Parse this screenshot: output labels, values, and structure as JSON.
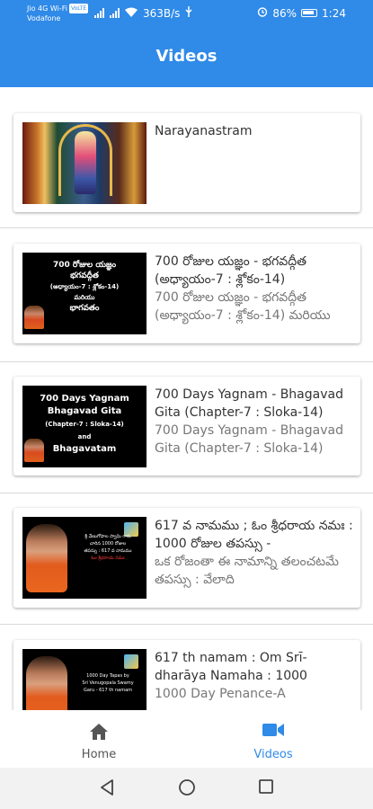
{
  "status_bar": {
    "carrier_top": "Jio 4G Wi-Fi",
    "lte_badge": "VoLTE",
    "carrier_bottom": "Vodafone",
    "net_speed": "363B/s",
    "battery": "86%",
    "time": "1:24"
  },
  "header": {
    "title": "Videos"
  },
  "videos": [
    {
      "title": "Narayanastram",
      "subtitle": ""
    },
    {
      "title": "700 రోజుల యజ్ఞం - భగవద్గీత (అధ్యాయం-7 : శ్లోకం-14)",
      "subtitle": "700 రోజుల యజ్ఞం - భగవద్గీత (అధ్యాయం-7 : శ్లోకం-14) మరియు",
      "thumb_lines": [
        "700 రోజుల యజ్ఞం",
        "భగవద్గీత",
        "(అధ్యాయం-7 : శ్లోకం-14)",
        "మరియు",
        "భాగవతం"
      ]
    },
    {
      "title": "700 Days Yagnam - Bhagavad Gita (Chapter-7 : Sloka-14)",
      "subtitle": "700 Days Yagnam - Bhagavad Gita (Chapter-7 : Sloka-14)",
      "thumb_lines": [
        "700 Days Yagnam",
        "Bhagavad Gita",
        "(Chapter-7 : Sloka-14)",
        "and",
        "Bhagavatam"
      ]
    },
    {
      "title": "617 వ నామము ; ఓం శ్రీధరాయ నమః : 1000 రోజుల తపస్సు -",
      "subtitle": "ఒక రోజంతా ఈ నామాన్ని తలంచటమే తపస్సు : వేలాది",
      "thumb_lines": [
        "శ్రీ వేణుగోపాల స్వామి గారు",
        "చారిన 1000 రోజుల",
        "తపస్సు : 617 వ నామము",
        "ఓం శ్రీధరాయ నమః"
      ]
    },
    {
      "title": "617 th namam : Om Srī-dharāya Namaha : 1000",
      "subtitle": "1000 Day Penance-A",
      "thumb_lines": [
        "1000 Day Tapas by",
        "Sri Venugopala Swamy",
        "Garu - 617 th namam"
      ]
    }
  ],
  "bottom_nav": {
    "items": [
      {
        "label": "Home",
        "icon": "home-icon",
        "active": false
      },
      {
        "label": "Videos",
        "icon": "video-camera-icon",
        "active": true
      }
    ],
    "active_color": "#2f8ae8",
    "inactive_color": "#555555"
  },
  "colors": {
    "primary": "#2f8ae8"
  }
}
